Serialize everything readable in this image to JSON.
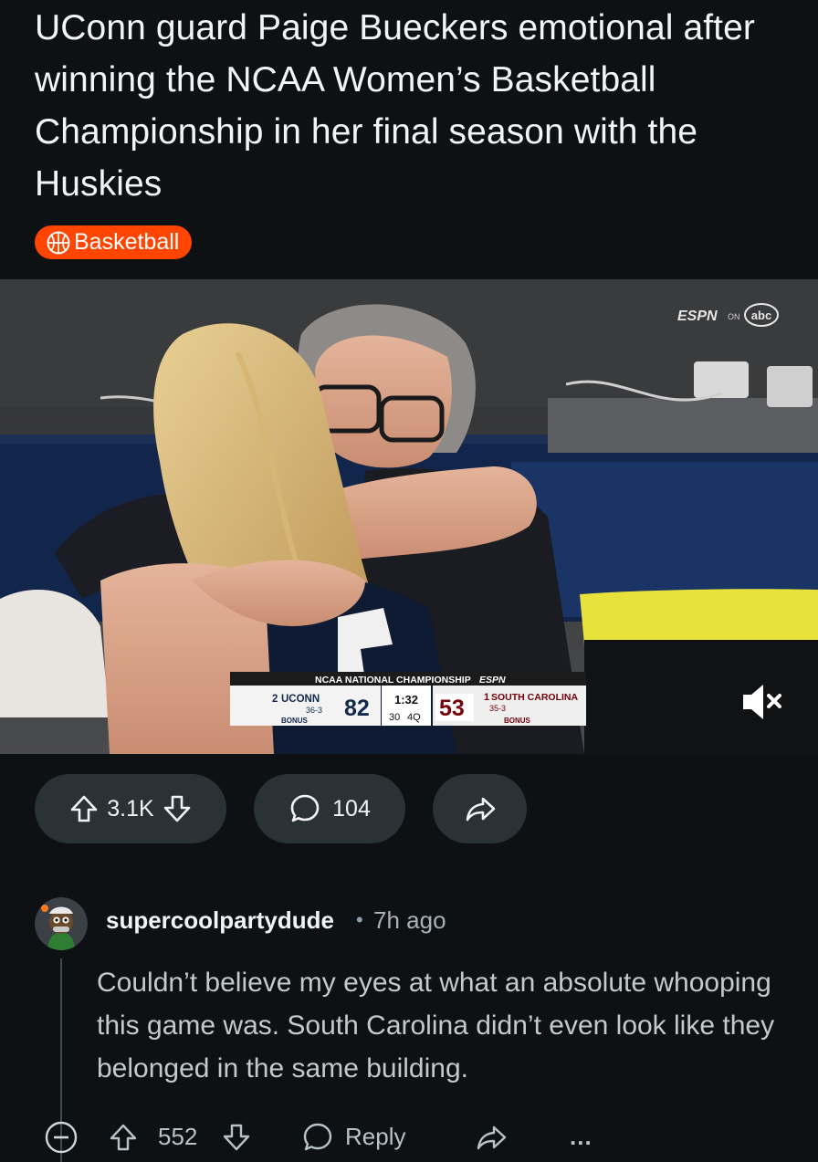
{
  "post": {
    "title": "UConn guard Paige Bueckers emotional after winning the NCAA Women’s Basketball Championship in her final season with the Huskies",
    "flair": "Basketball",
    "flair_icon": "basketball-icon",
    "flair_color": "#ff4500"
  },
  "video": {
    "network_logo": "ESPN",
    "network_on": "ON",
    "network_abc": "abc",
    "scoreboard": {
      "event": "NCAA NATIONAL CHAMPIONSHIP",
      "event_logo": "ESPN",
      "home_seed": "2",
      "home_team": "UCONN",
      "home_record": "36-3",
      "home_bonus": "BONUS",
      "home_score": "82",
      "clock": "1:32",
      "shot_clock": "30",
      "period": "4Q",
      "away_score": "53",
      "away_seed": "1",
      "away_team": "SOUTH CAROLINA",
      "away_record": "35-3",
      "away_bonus": "BONUS"
    },
    "muted": true
  },
  "actions": {
    "votes": "3.1K",
    "comments": "104",
    "upvote_icon": "upvote-icon",
    "downvote_icon": "downvote-icon",
    "comment_icon": "comment-icon",
    "share_icon": "share-icon"
  },
  "comment": {
    "username": "supercoolpartydude",
    "separator": "•",
    "time": "7h ago",
    "body": "Couldn’t believe my eyes at what an absolute whooping this game was. South Carolina didn’t even look like they belonged in the same building.",
    "votes": "552",
    "reply_label": "Reply",
    "more_label": "..."
  },
  "colors": {
    "background": "#0e1113",
    "pill": "#2a3236",
    "accent": "#ff4500",
    "uconn_navy": "#13294b",
    "gamecock_garnet": "#73000a"
  }
}
